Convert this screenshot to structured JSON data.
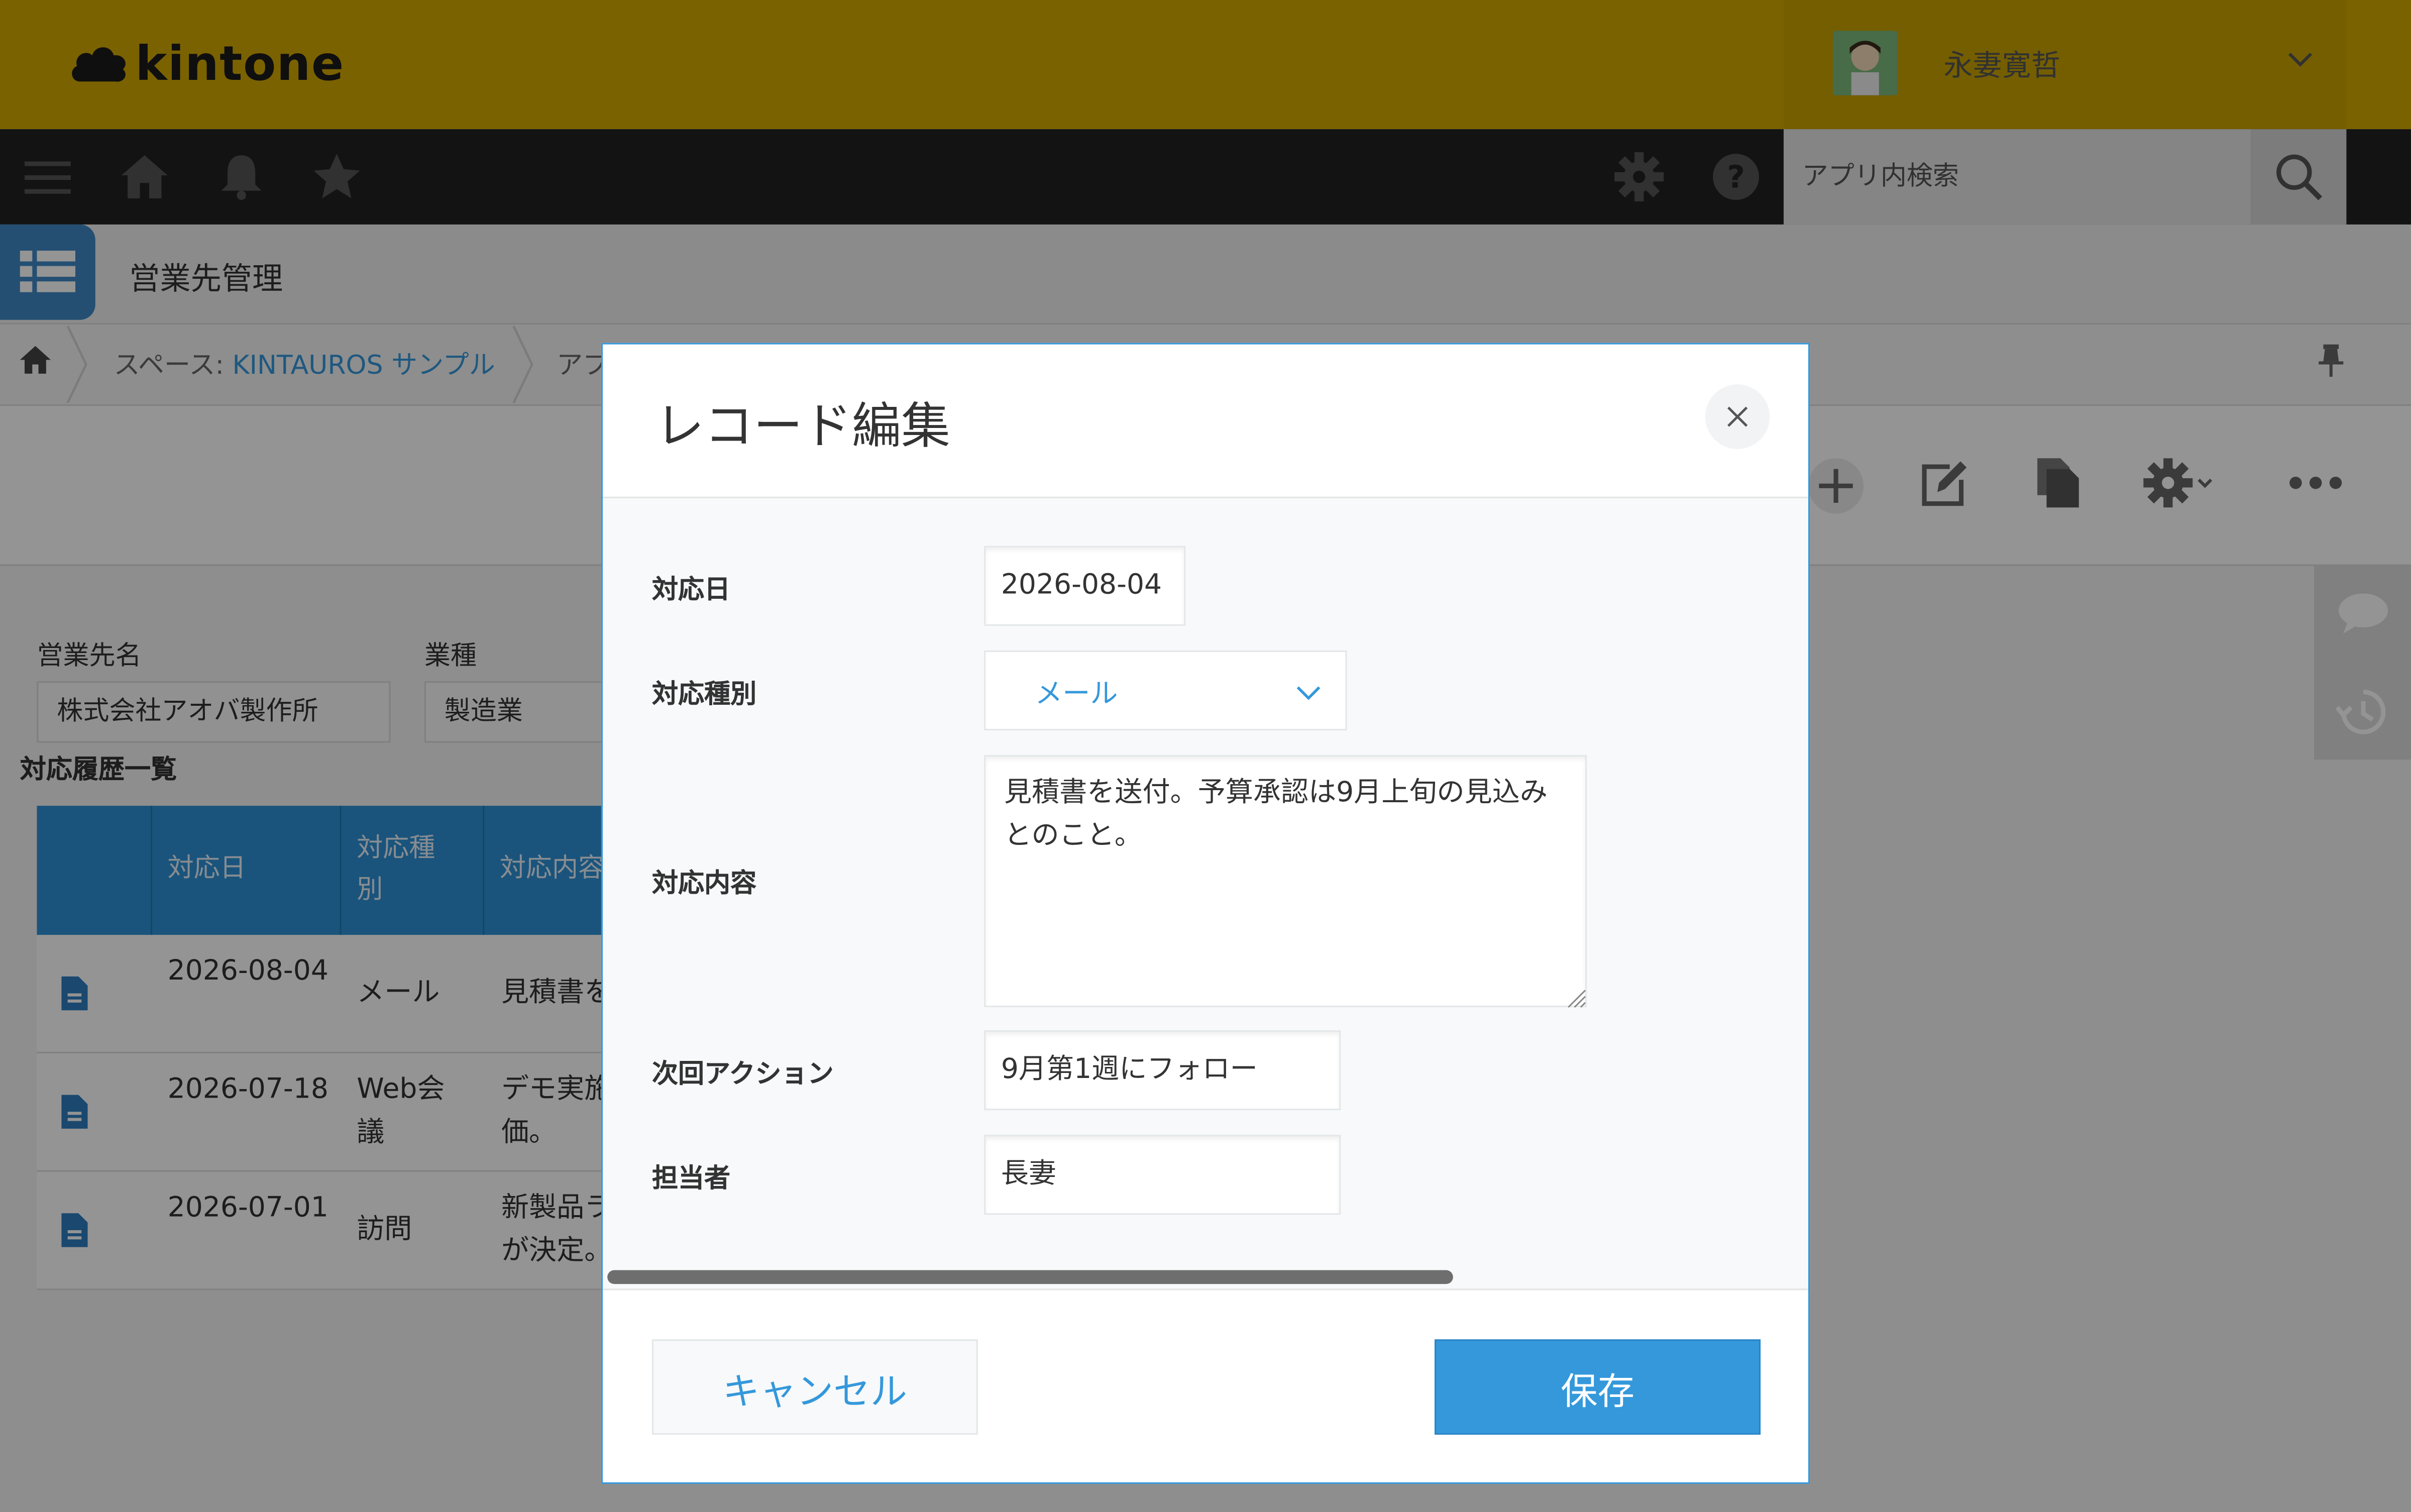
{
  "header": {
    "logo_text": "kintone",
    "user_name": "永妻寛哲"
  },
  "nav": {
    "search_placeholder": "アプリ内検索"
  },
  "app": {
    "name": "営業先管理"
  },
  "breadcrumb": {
    "space_prefix": "スペース: ",
    "space_name": "KINTAUROS サンプル",
    "app_prefix": "アプ"
  },
  "record": {
    "fields": [
      {
        "label": "営業先名",
        "value": "株式会社アオバ製作所"
      },
      {
        "label": "業種",
        "value": "製造業"
      }
    ],
    "history_title": "対応履歴一覧",
    "table": {
      "headers": [
        "対応日",
        "対応種別",
        "対応内容"
      ],
      "rows": [
        {
          "date": "2026-08-04",
          "type": "メール",
          "content": "見積書を"
        },
        {
          "date": "2026-07-18",
          "type": "Web会議",
          "content": "デモ実施 価。"
        },
        {
          "date": "2026-07-01",
          "type": "訪問",
          "content": "新製品ラ が決定。"
        }
      ]
    }
  },
  "dialog": {
    "title": "レコード編集",
    "fields": {
      "date_label": "対応日",
      "date_value": "2026-08-04",
      "type_label": "対応種別",
      "type_value": "メール",
      "content_label": "対応内容",
      "content_value": "見積書を送付。予算承認は9月上旬の見込みとのこと。",
      "next_label": "次回アクション",
      "next_value": "9月第1週にフォロー",
      "owner_label": "担当者",
      "owner_value": "長妻"
    },
    "cancel_label": "キャンセル",
    "save_label": "保存"
  },
  "colors": {
    "header_bg": "#d4a900",
    "accent": "#3498db",
    "nav_bg": "#222222"
  }
}
